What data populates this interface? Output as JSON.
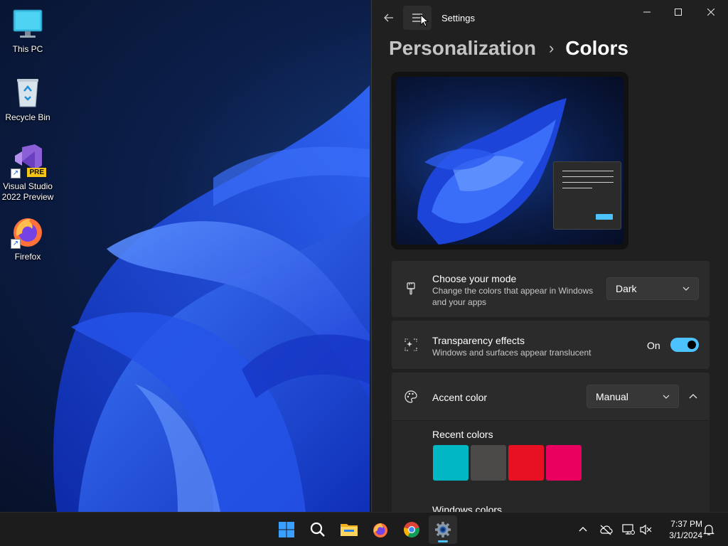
{
  "desktop": {
    "icons": [
      {
        "label": "This PC",
        "icon": "monitor-icon"
      },
      {
        "label": "Recycle Bin",
        "icon": "recycle-bin-icon"
      },
      {
        "label": "Visual Studio 2022 Preview",
        "icon": "visual-studio-icon",
        "badge": "PRE"
      },
      {
        "label": "Firefox",
        "icon": "firefox-icon"
      }
    ]
  },
  "settings": {
    "window_title": "Settings",
    "breadcrumb": {
      "parent": "Personalization",
      "separator": "›",
      "current": "Colors"
    },
    "mode": {
      "title": "Choose your mode",
      "description": "Change the colors that appear in Windows and your apps",
      "value": "Dark"
    },
    "transparency": {
      "title": "Transparency effects",
      "description": "Windows and surfaces appear translucent",
      "state_label": "On",
      "enabled": true
    },
    "accent": {
      "title": "Accent color",
      "value": "Manual",
      "expanded": true,
      "recent_title": "Recent colors",
      "recent_colors": [
        "#00b7c3",
        "#4c4a48",
        "#e81123",
        "#ea005e"
      ],
      "windows_colors_title": "Windows colors"
    }
  },
  "taskbar": {
    "apps": [
      {
        "name": "start-button",
        "icon": "windows-logo-icon"
      },
      {
        "name": "search-button",
        "icon": "search-icon"
      },
      {
        "name": "file-explorer-button",
        "icon": "folder-icon"
      },
      {
        "name": "firefox-taskbar-button",
        "icon": "firefox-icon"
      },
      {
        "name": "chrome-taskbar-button",
        "icon": "chrome-icon"
      },
      {
        "name": "settings-taskbar-button",
        "icon": "gear-icon",
        "active": true
      }
    ],
    "clock": {
      "time": "7:37 PM",
      "date": "3/1/2024"
    }
  },
  "colors": {
    "accent": "#4cc2ff",
    "window_bg": "#202020",
    "card_bg": "#2b2b2b"
  }
}
